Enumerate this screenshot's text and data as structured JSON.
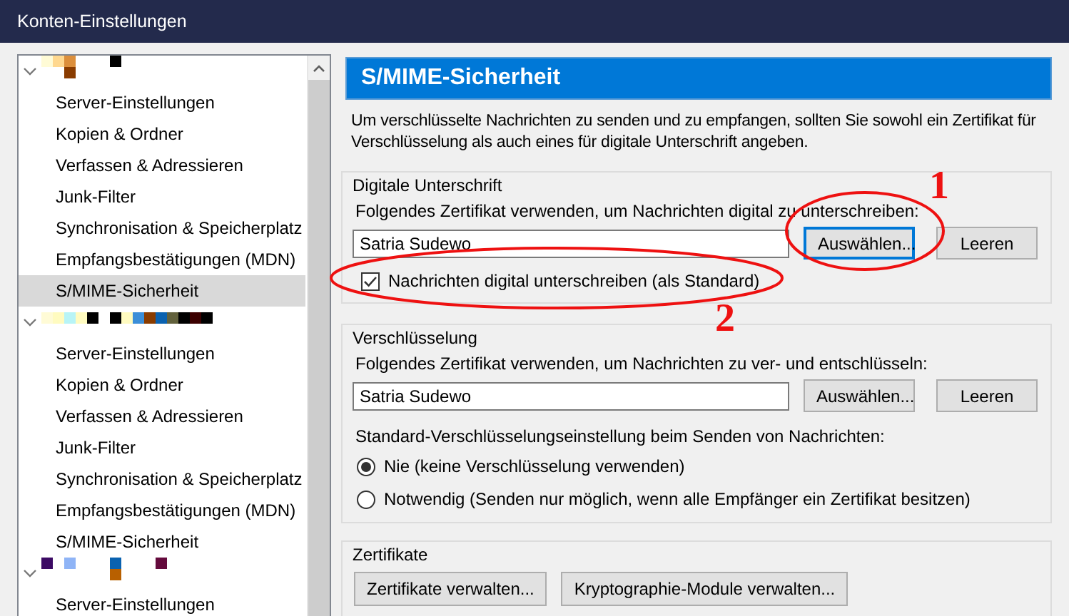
{
  "window": {
    "title": "Konten-Einstellungen"
  },
  "sidebar": {
    "accounts": [
      {
        "expanded": true,
        "children": [
          {
            "label": "Server-Einstellungen",
            "selected": false
          },
          {
            "label": "Kopien & Ordner",
            "selected": false
          },
          {
            "label": "Verfassen & Adressieren",
            "selected": false
          },
          {
            "label": "Junk-Filter",
            "selected": false
          },
          {
            "label": "Synchronisation & Speicherplatz",
            "selected": false
          },
          {
            "label": "Empfangsbestätigungen (MDN)",
            "selected": false
          },
          {
            "label": "S/MIME-Sicherheit",
            "selected": true
          }
        ]
      },
      {
        "expanded": true,
        "children": [
          {
            "label": "Server-Einstellungen",
            "selected": false
          },
          {
            "label": "Kopien & Ordner",
            "selected": false
          },
          {
            "label": "Verfassen & Adressieren",
            "selected": false
          },
          {
            "label": "Junk-Filter",
            "selected": false
          },
          {
            "label": "Synchronisation & Speicherplatz",
            "selected": false
          },
          {
            "label": "Empfangsbestätigungen (MDN)",
            "selected": false
          },
          {
            "label": "S/MIME-Sicherheit",
            "selected": false
          }
        ]
      },
      {
        "expanded": true,
        "children": [
          {
            "label": "Server-Einstellungen",
            "selected": false
          }
        ]
      }
    ]
  },
  "page": {
    "title": "S/MIME-Sicherheit",
    "description": "Um verschlüsselte Nachrichten zu senden und zu empfangen, sollten Sie sowohl ein Zertifikat für Verschlüsselung als auch eines für digitale Unterschrift angeben.",
    "signing": {
      "legend": "Digitale Unterschrift",
      "label": "Folgendes Zertifikat verwenden, um Nachrichten digital zu unterschreiben:",
      "value": "Satria Sudewo",
      "buttons": [
        {
          "label": "Auswählen...",
          "focused": true
        },
        {
          "label": "Leeren",
          "focused": false
        }
      ],
      "checkbox": {
        "label": "Nachrichten digital unterschreiben (als Standard)",
        "checked": true
      }
    },
    "encryption": {
      "legend": "Verschlüsselung",
      "label": "Folgendes Zertifikat verwenden, um Nachrichten zu ver- und entschlüsseln:",
      "value": "Satria Sudewo",
      "buttons": [
        {
          "label": "Auswählen...",
          "focused": false
        },
        {
          "label": "Leeren",
          "focused": false
        }
      ],
      "default_label": "Standard-Verschlüsselungseinstellung beim Senden von Nachrichten:",
      "options": [
        {
          "label": "Nie (keine Verschlüsselung verwenden)",
          "selected": true
        },
        {
          "label": "Notwendig (Senden nur möglich, wenn alle Empfänger ein Zertifikat besitzen)",
          "selected": false
        }
      ]
    },
    "certificates": {
      "legend": "Zertifikate",
      "buttons": [
        {
          "label": "Zertifikate verwalten...",
          "focused": false
        },
        {
          "label": "Kryptographie-Module verwalten...",
          "focused": false
        }
      ]
    }
  },
  "annotations": [
    {
      "label": "1"
    },
    {
      "label": "2"
    }
  ]
}
